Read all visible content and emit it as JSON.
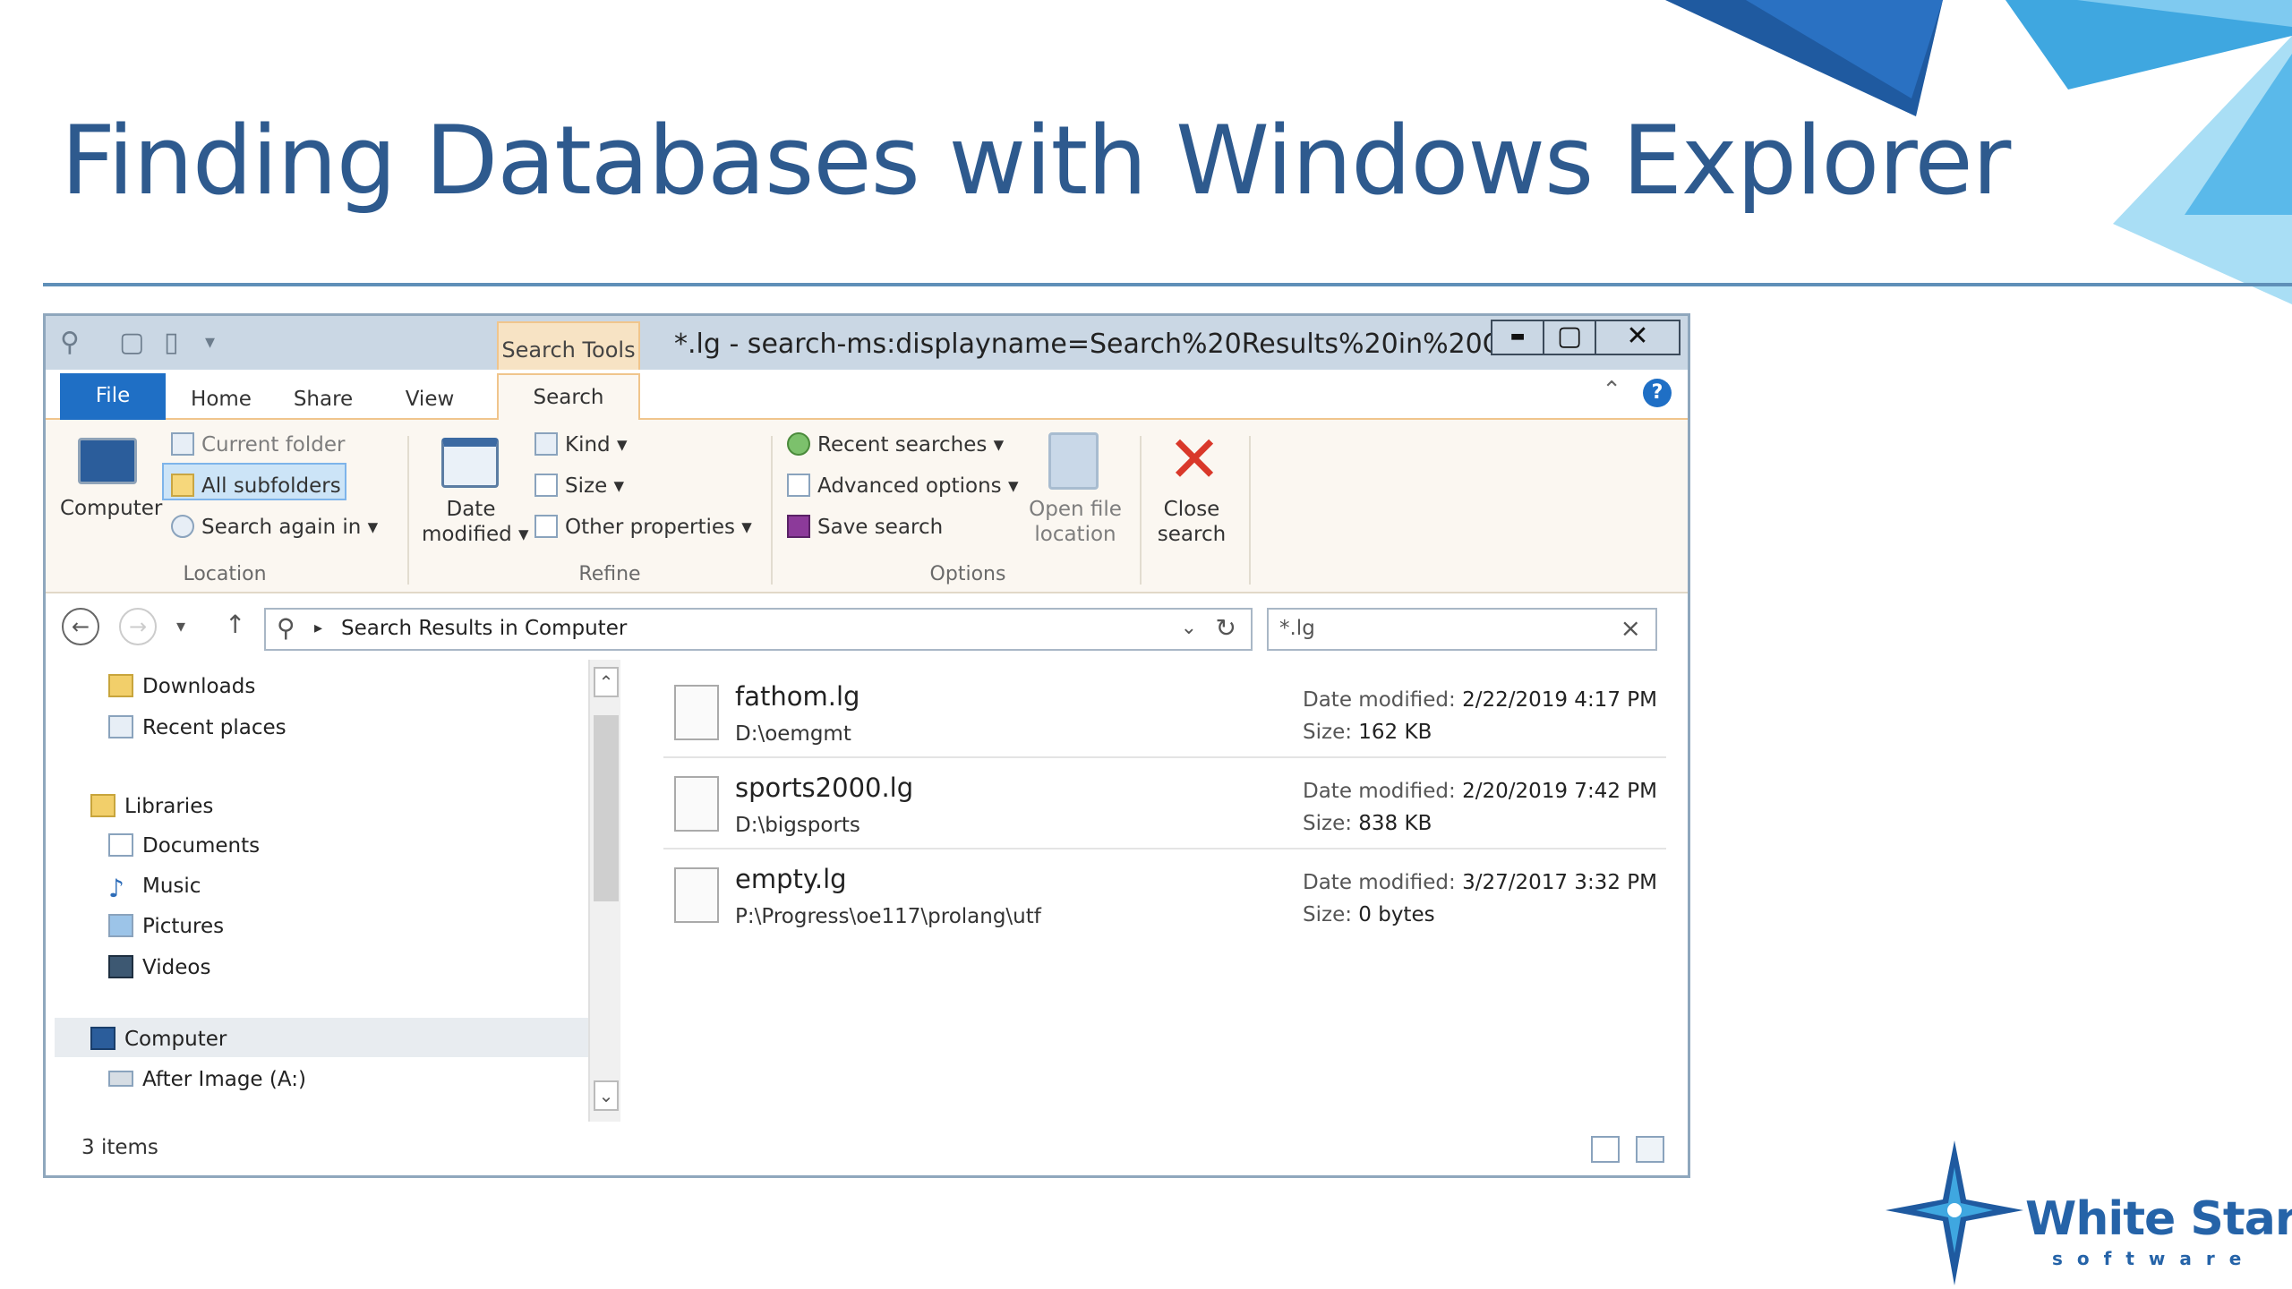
{
  "slide": {
    "title": "Finding Databases with Windows Explorer"
  },
  "window": {
    "title": "*.lg - search-ms:displayname=Search%20Results%20in%20Co...",
    "contextual_tab": "Search Tools",
    "controls": {
      "minimize": "▬",
      "maximize": "▢",
      "close": "✕"
    },
    "tabs": {
      "file": "File",
      "home": "Home",
      "share": "Share",
      "view": "View",
      "search": "Search"
    },
    "help": "?"
  },
  "ribbon": {
    "location": {
      "computer": "Computer",
      "current_folder": "Current folder",
      "all_subfolders": "All subfolders",
      "search_again": "Search again in",
      "label": "Location"
    },
    "refine": {
      "date_modified_1": "Date",
      "date_modified_2": "modified",
      "kind": "Kind",
      "size": "Size",
      "other_properties": "Other properties",
      "label": "Refine"
    },
    "options": {
      "recent_searches": "Recent searches",
      "advanced_options": "Advanced options",
      "save_search": "Save search",
      "open_file_location_1": "Open file",
      "open_file_location_2": "location",
      "label": "Options"
    },
    "close_search_1": "Close",
    "close_search_2": "search"
  },
  "address": {
    "path": "Search Results in Computer",
    "search_value": "*.lg"
  },
  "nav": {
    "items": [
      {
        "label": "Downloads",
        "icon": "downloads-icon"
      },
      {
        "label": "Recent places",
        "icon": "recent-places-icon"
      },
      {
        "label": "Libraries",
        "icon": "libraries-icon"
      },
      {
        "label": "Documents",
        "icon": "documents-icon"
      },
      {
        "label": "Music",
        "icon": "music-icon"
      },
      {
        "label": "Pictures",
        "icon": "pictures-icon"
      },
      {
        "label": "Videos",
        "icon": "videos-icon"
      },
      {
        "label": "Computer",
        "icon": "computer-icon"
      },
      {
        "label": "After Image (A:)",
        "icon": "drive-icon"
      }
    ]
  },
  "files": [
    {
      "name": "fathom.lg",
      "path": "D:\\oemgmt",
      "date_label": "Date modified:",
      "date": "2/22/2019 4:17 PM",
      "size_label": "Size:",
      "size": "162 KB"
    },
    {
      "name": "sports2000.lg",
      "path": "D:\\bigsports",
      "date_label": "Date modified:",
      "date": "2/20/2019 7:42 PM",
      "size_label": "Size:",
      "size": "838 KB"
    },
    {
      "name": "empty.lg",
      "path": "P:\\Progress\\oe117\\prolang\\utf",
      "date_label": "Date modified:",
      "date": "3/27/2017 3:32 PM",
      "size_label": "Size:",
      "size": "0 bytes"
    }
  ],
  "status": {
    "items": "3 items"
  },
  "logo": {
    "name": "White Star",
    "sub": "software"
  },
  "colors": {
    "title_blue": "#2e5a8e",
    "file_tab_blue": "#1f6fc5",
    "search_tools_orange": "#f7e3c4",
    "close_red": "#d9382a"
  }
}
